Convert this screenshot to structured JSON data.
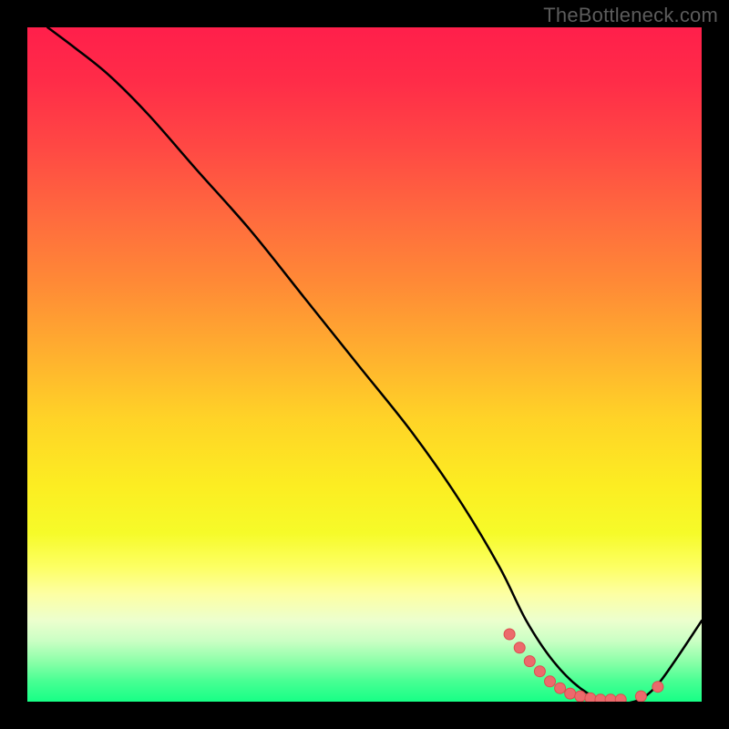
{
  "watermark": "TheBottleneck.com",
  "chart_data": {
    "type": "line",
    "title": "",
    "xlabel": "",
    "ylabel": "",
    "xlim": [
      0,
      100
    ],
    "ylim": [
      0,
      100
    ],
    "series": [
      {
        "name": "curve",
        "x": [
          3,
          7,
          12,
          18,
          25,
          33,
          41,
          49,
          57,
          64,
          70,
          74,
          78,
          82,
          86,
          90,
          93,
          96,
          100
        ],
        "y": [
          100,
          97,
          93,
          87,
          79,
          70,
          60,
          50,
          40,
          30,
          20,
          12,
          6,
          2,
          0,
          0,
          2,
          6,
          12
        ]
      },
      {
        "name": "markers",
        "x": [
          71.5,
          73,
          74.5,
          76,
          77.5,
          79,
          80.5,
          82,
          83.5,
          85,
          86.5,
          88,
          91,
          93.5
        ],
        "y": [
          10,
          8,
          6,
          4.5,
          3,
          2,
          1.2,
          0.8,
          0.5,
          0.3,
          0.3,
          0.3,
          0.8,
          2.2
        ]
      }
    ],
    "colors": {
      "curve": "#000000",
      "markers_fill": "#ec6a6c",
      "markers_stroke": "#dc4c4e"
    }
  }
}
